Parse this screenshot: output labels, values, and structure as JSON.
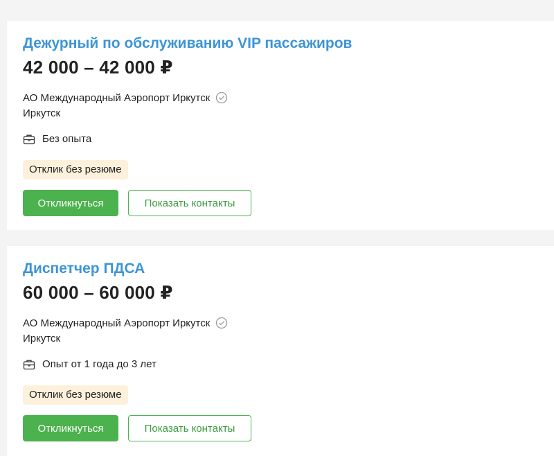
{
  "colors": {
    "title": "#3c95d6",
    "primary": "#4bb24e",
    "badge_bg": "#fdf1dc",
    "page_bg": "#f4f4f5"
  },
  "vacancies": [
    {
      "title": "Дежурный по обслуживанию VIP пассажиров",
      "salary": "42 000 – 42 000 ₽",
      "company": "АО Международный Аэропорт Иркутск",
      "company_verified_icon": "check-circle-icon",
      "city": "Иркутск",
      "experience_icon": "briefcase-icon",
      "experience": "Без опыта",
      "badge": "Отклик без резюме",
      "respond_label": "Откликнуться",
      "contacts_label": "Показать контакты"
    },
    {
      "title": "Диспетчер ПДСА",
      "salary": "60 000 – 60 000 ₽",
      "company": "АО Международный Аэропорт Иркутск",
      "company_verified_icon": "check-circle-icon",
      "city": "Иркутск",
      "experience_icon": "briefcase-icon",
      "experience": "Опыт от 1 года до 3 лет",
      "badge": "Отклик без резюме",
      "respond_label": "Откликнуться",
      "contacts_label": "Показать контакты"
    }
  ]
}
